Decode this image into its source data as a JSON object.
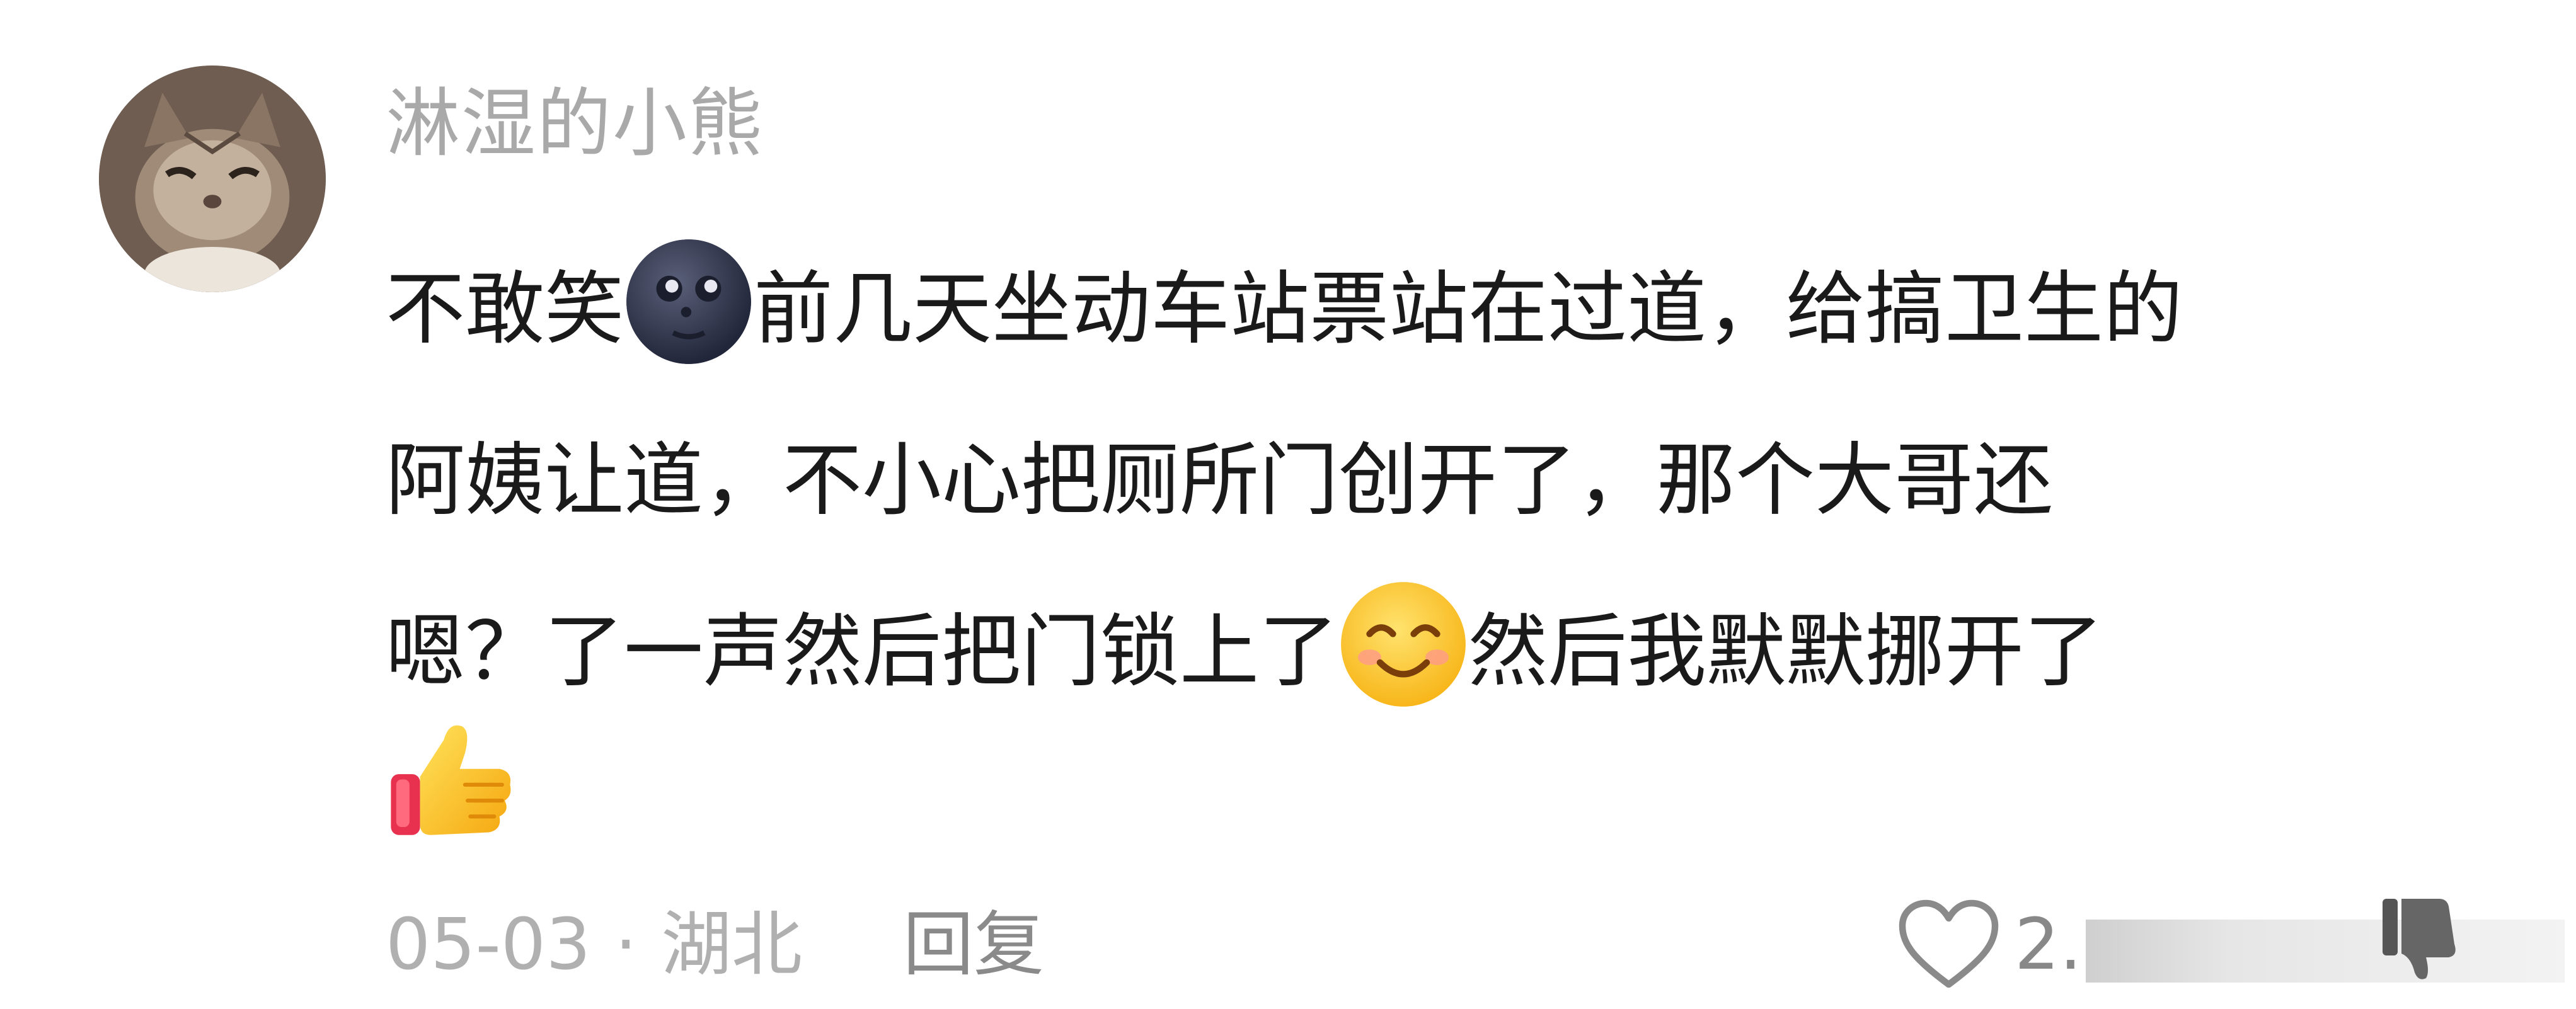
{
  "comment": {
    "username": "淋湿的小熊",
    "lines": [
      {
        "before": "不敢笑",
        "emoji": "new-moon-face-emoji",
        "after": "前几天坐动车站票站在过道，给搞卫生的"
      },
      {
        "text": "阿姨让道，不小心把厕所门创开了，那个大哥还"
      },
      {
        "before": "嗯？了一声然后把门锁上了",
        "emoji": "smiling-face-emoji",
        "after": "然后我默默挪开了"
      }
    ],
    "trailing_emoji": "thumbs-up-emoji",
    "date": "05-03",
    "separator": "·",
    "location": "湖北",
    "reply_label": "回复",
    "like_count": "2.",
    "like_icon": "heart-outline-icon",
    "dislike_icon": "thumbs-down-icon"
  },
  "colors": {
    "username": "#a9a9a9",
    "body_text": "#1a1a1a",
    "meta_text": "#b0b0b0",
    "background": "#ffffff"
  }
}
